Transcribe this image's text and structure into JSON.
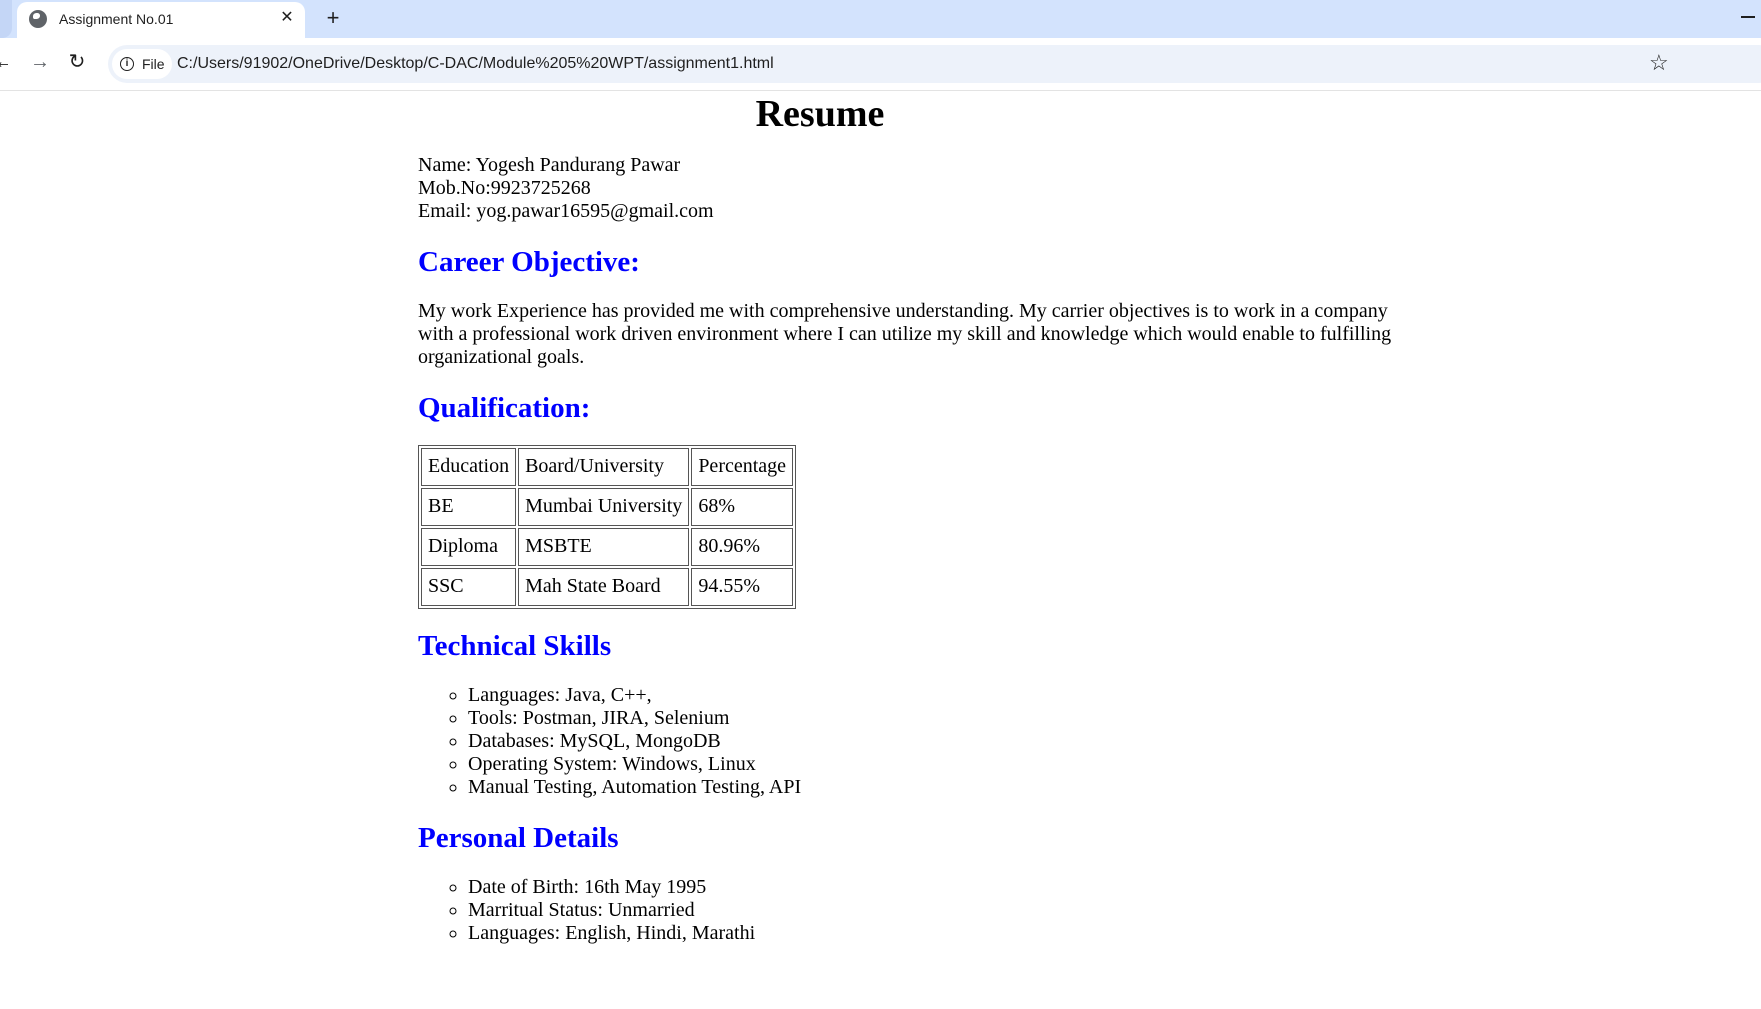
{
  "browser": {
    "tab_title": "Assignment No.01",
    "tab_close": "✕",
    "new_tab": "+",
    "site_chip": "File",
    "url": "C:/Users/91902/OneDrive/Desktop/C-DAC/Module%205%20WPT/assignment1.html",
    "icons": [
      "back-arrow-icon",
      "forward-arrow-icon",
      "reload-icon",
      "info-icon",
      "star-icon",
      "globe-favicon-icon"
    ]
  },
  "resume": {
    "title": "Resume",
    "contact": {
      "name": "Name: Yogesh Pandurang Pawar",
      "mobile": "Mob.No:9923725268",
      "email": "Email: yog.pawar16595@gmail.com"
    },
    "career": {
      "heading": "Career Objective:",
      "text": "My work Experience has provided me with comprehensive understanding. My carrier objectives is to work in a company with a professional work driven environment where I can utilize my skill and knowledge which would enable to fulfilling organizational goals."
    },
    "qualification": {
      "heading": "Qualification:",
      "headers": [
        "Education",
        "Board/University",
        "Percentage"
      ],
      "rows": [
        [
          "BE",
          "Mumbai University",
          "68%"
        ],
        [
          "Diploma",
          "MSBTE",
          "80.96%"
        ],
        [
          "SSC",
          "Mah State Board",
          "94.55%"
        ]
      ]
    },
    "skills": {
      "heading": "Technical Skills",
      "items": [
        "Languages: Java, C++,",
        "Tools: Postman, JIRA, Selenium",
        "Databases: MySQL, MongoDB",
        "Operating System: Windows, Linux",
        "Manual Testing, Automation Testing, API"
      ]
    },
    "personal": {
      "heading": "Personal Details",
      "items": [
        "Date of Birth: 16th May 1995",
        "Marritual Status: Unmarried",
        "Languages: English, Hindi, Marathi"
      ]
    }
  },
  "colors": {
    "heading_blue": "#0000ff",
    "tabstrip_bg": "#d3e3fd",
    "omnibox_bg": "#edf2fa"
  }
}
